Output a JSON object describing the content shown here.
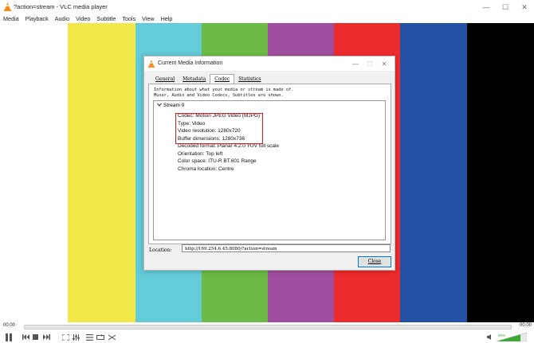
{
  "window": {
    "title": "?action=stream - VLC media player"
  },
  "menu": [
    "Media",
    "Playback",
    "Audio",
    "Video",
    "Subtitle",
    "Tools",
    "View",
    "Help"
  ],
  "video_bars": [
    "#ffffff",
    "#f1e947",
    "#64cbd8",
    "#6bbb44",
    "#9f4f9e",
    "#ee2b2c",
    "#2251a3",
    "#000000"
  ],
  "dialog": {
    "title": "Current Media Information",
    "tabs": [
      "General",
      "Metadata",
      "Codec",
      "Statistics"
    ],
    "active_tab": "Codec",
    "info_line1": "Information about what your media or stream is made of.",
    "info_line2": "Muxer, Audio and Video Codecs, Subtitles are shown.",
    "stream_label": "Stream 0",
    "items": [
      "Codec: Motion JPEG Video (MJPG)",
      "Type: Video",
      "Video resolution: 1280x720",
      "Buffer dimensions: 1280x736",
      "Decoded format: Planar 4:2:0 YUV full scale",
      "Orientation: Top left",
      "Color space: ITU-R BT.601 Range",
      "Chroma location: Centre"
    ],
    "location_label": "Location:",
    "location_value": "http://169.254.6.45:8080/?action=stream",
    "close_label": "Close"
  },
  "player": {
    "time_elapsed": "00:00",
    "time_total": "00:00",
    "volume": "80%",
    "accent": "#3aaa35"
  }
}
